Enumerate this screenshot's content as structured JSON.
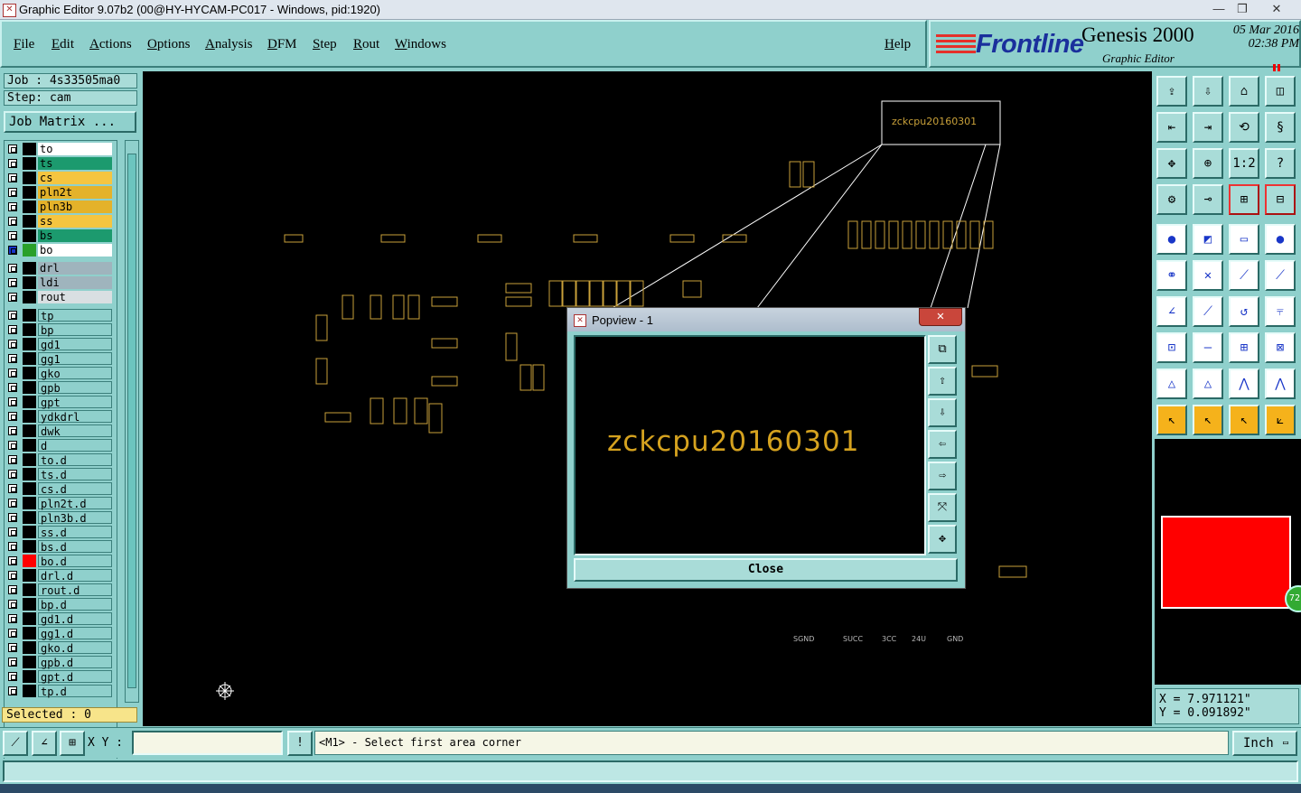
{
  "window": {
    "title": "Graphic Editor 9.07b2 (00@HY-HYCAM-PC017 - Windows, pid:1920)",
    "controls": [
      "minimize-icon",
      "restore-icon",
      "close-icon"
    ]
  },
  "menu": {
    "items": [
      "File",
      "Edit",
      "Actions",
      "Options",
      "Analysis",
      "DFM",
      "Step",
      "Rout",
      "Windows"
    ],
    "help": "Help"
  },
  "brand": {
    "logo": "Frontline",
    "product": "Genesis 2000",
    "subtitle": "Graphic Editor",
    "date": "05 Mar 2016",
    "time": "02:38 PM"
  },
  "job": {
    "job_line": "Job : 4s33505ma0",
    "step_line": "Step: cam",
    "matrix_button": "Job Matrix ..."
  },
  "layers": [
    {
      "name": "to",
      "color": "#ffffff",
      "swatch": "#000000"
    },
    {
      "name": "ts",
      "color": "#1c9a6e",
      "swatch": "#000000"
    },
    {
      "name": "cs",
      "color": "#f5c540",
      "swatch": "#000000"
    },
    {
      "name": "pln2t",
      "color": "#e4b22a",
      "swatch": "#000000"
    },
    {
      "name": "pln3b",
      "color": "#e4b22a",
      "swatch": "#000000"
    },
    {
      "name": "ss",
      "color": "#f5c540",
      "swatch": "#000000"
    },
    {
      "name": "bs",
      "color": "#1c9a6e",
      "swatch": "#000000"
    },
    {
      "name": "bo",
      "color": "#ffffff",
      "swatch": "#2aa02a",
      "active": true
    },
    {
      "name": "drl",
      "color": "#9fb4bd",
      "swatch": "#000000",
      "group_gap": true
    },
    {
      "name": "ldi",
      "color": "#9fb4bd",
      "swatch": "#000000"
    },
    {
      "name": "rout",
      "color": "#d9dfe2",
      "swatch": "#000000"
    },
    {
      "name": "tp",
      "color": "#8fd0cc",
      "swatch": "#000000",
      "group_gap": true
    },
    {
      "name": "bp",
      "color": "#8fd0cc",
      "swatch": "#000000"
    },
    {
      "name": "gd1",
      "color": "#8fd0cc",
      "swatch": "#000000"
    },
    {
      "name": "gg1",
      "color": "#8fd0cc",
      "swatch": "#000000"
    },
    {
      "name": "gko",
      "color": "#8fd0cc",
      "swatch": "#000000"
    },
    {
      "name": "gpb",
      "color": "#8fd0cc",
      "swatch": "#000000"
    },
    {
      "name": "gpt",
      "color": "#8fd0cc",
      "swatch": "#000000"
    },
    {
      "name": "ydkdrl",
      "color": "#8fd0cc",
      "swatch": "#000000"
    },
    {
      "name": "dwk",
      "color": "#8fd0cc",
      "swatch": "#000000"
    },
    {
      "name": "d",
      "color": "#8fd0cc",
      "swatch": "#000000"
    },
    {
      "name": "to.d",
      "color": "#8fd0cc",
      "swatch": "#000000"
    },
    {
      "name": "ts.d",
      "color": "#8fd0cc",
      "swatch": "#000000"
    },
    {
      "name": "cs.d",
      "color": "#8fd0cc",
      "swatch": "#000000"
    },
    {
      "name": "pln2t.d",
      "color": "#8fd0cc",
      "swatch": "#000000"
    },
    {
      "name": "pln3b.d",
      "color": "#8fd0cc",
      "swatch": "#000000"
    },
    {
      "name": "ss.d",
      "color": "#8fd0cc",
      "swatch": "#000000"
    },
    {
      "name": "bs.d",
      "color": "#8fd0cc",
      "swatch": "#000000"
    },
    {
      "name": "bo.d",
      "color": "#8fd0cc",
      "swatch": "#ff0000"
    },
    {
      "name": "drl.d",
      "color": "#8fd0cc",
      "swatch": "#000000"
    },
    {
      "name": "rout.d",
      "color": "#8fd0cc",
      "swatch": "#000000"
    },
    {
      "name": "bp.d",
      "color": "#8fd0cc",
      "swatch": "#000000"
    },
    {
      "name": "gd1.d",
      "color": "#8fd0cc",
      "swatch": "#000000"
    },
    {
      "name": "gg1.d",
      "color": "#8fd0cc",
      "swatch": "#000000"
    },
    {
      "name": "gko.d",
      "color": "#8fd0cc",
      "swatch": "#000000"
    },
    {
      "name": "gpb.d",
      "color": "#8fd0cc",
      "swatch": "#000000"
    },
    {
      "name": "gpt.d",
      "color": "#8fd0cc",
      "swatch": "#000000"
    },
    {
      "name": "tp.d",
      "color": "#8fd0cc",
      "swatch": "#000000"
    }
  ],
  "selected": "Selected : 0",
  "canvas": {
    "callout_text": "zckcpu20160301",
    "net_labels": [
      "SGND",
      "SUCC",
      "3CC",
      "24U",
      "GND"
    ],
    "pcb_color": "#c9a13a"
  },
  "popview": {
    "title": "Popview - 1",
    "text": "zckcpu20160301",
    "close_label": "Close",
    "side_icons": [
      "fit-icon",
      "pan-up-icon",
      "pan-down-icon",
      "pan-left-icon",
      "pan-right-icon",
      "zoom-out-icon",
      "zoom-in-icon"
    ]
  },
  "coords": {
    "x": "X = 7.971121\"",
    "y": "Y = 0.091892\""
  },
  "command": {
    "xy_label": "X Y :",
    "xy_value": "",
    "prompt": "<M1> - Select first area corner",
    "unit": "Inch"
  }
}
